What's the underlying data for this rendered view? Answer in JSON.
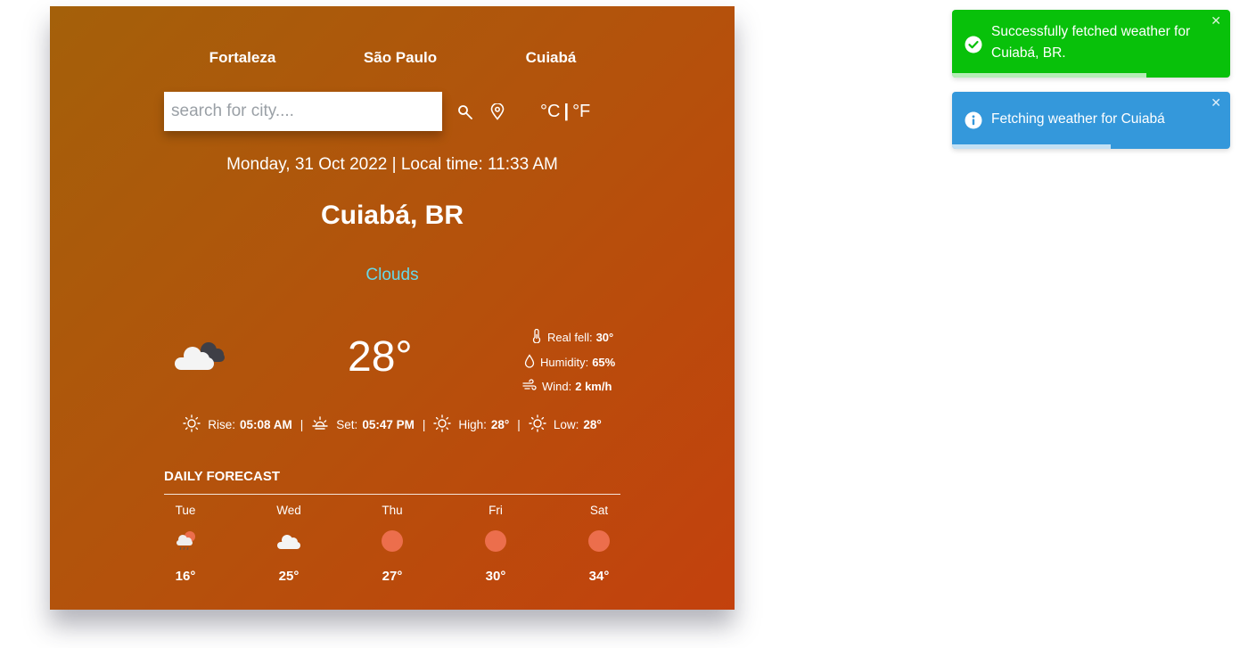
{
  "top_cities": [
    "Fortaleza",
    "São Paulo",
    "Cuiabá"
  ],
  "search": {
    "placeholder": "search for city....",
    "value": ""
  },
  "icons": {
    "search": "search-icon",
    "location": "location-pin-icon"
  },
  "units": {
    "celsius": "°C",
    "separator": "|",
    "fahrenheit": "°F"
  },
  "datetime": "Monday, 31 Oct 2022 | Local time: 11:33 AM",
  "location": "Cuiabá, BR",
  "condition": "Clouds",
  "temperature": "28°",
  "details": {
    "feels_label": "Real fell:",
    "feels_value": "30°",
    "humidity_label": "Humidity:",
    "humidity_value": "65%",
    "wind_label": "Wind:",
    "wind_value": "2 km/h"
  },
  "sun": {
    "rise_label": "Rise:",
    "rise_value": "05:08 AM",
    "set_label": "Set:",
    "set_value": "05:47 PM",
    "high_label": "High:",
    "high_value": "28°",
    "low_label": "Low:",
    "low_value": "28°",
    "separator": "|"
  },
  "forecast": {
    "title": "DAILY FORECAST",
    "days": [
      {
        "day": "Tue",
        "temp": "16°",
        "icon": "rain-cloud-sun-icon"
      },
      {
        "day": "Wed",
        "temp": "25°",
        "icon": "cloud-icon"
      },
      {
        "day": "Thu",
        "temp": "27°",
        "icon": "sun-icon"
      },
      {
        "day": "Fri",
        "temp": "30°",
        "icon": "sun-icon"
      },
      {
        "day": "Sat",
        "temp": "34°",
        "icon": "sun-icon"
      }
    ]
  },
  "toasts": [
    {
      "type": "success",
      "message": "Successfully fetched weather for Cuiabá, BR.",
      "close": "✕",
      "progress": 0.7
    },
    {
      "type": "info",
      "message": "Fetching weather for Cuiabá",
      "close": "✕",
      "progress": 0.57
    }
  ],
  "colors": {
    "gradient_start": "#a4600a",
    "gradient_end": "#c3410d",
    "condition": "#67d8e8",
    "success": "#08c10a",
    "info": "#3498db",
    "sun": "#ec6e4c"
  }
}
